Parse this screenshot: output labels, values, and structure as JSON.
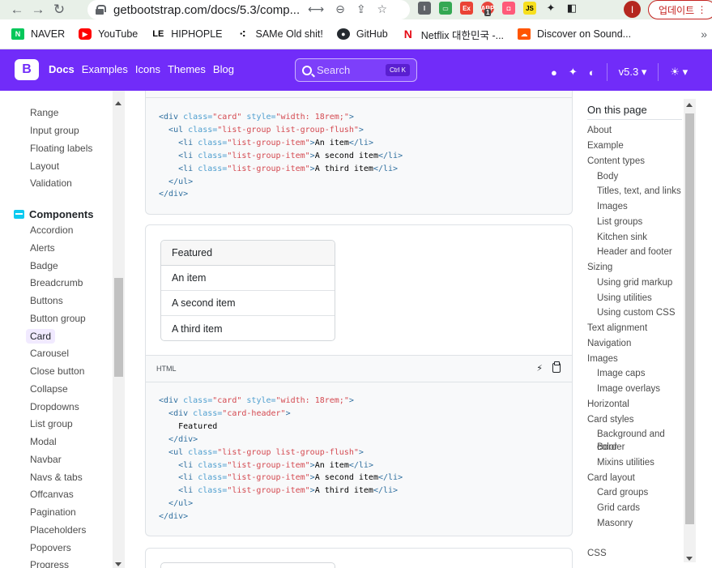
{
  "browser": {
    "url": "getbootstrap.com/docs/5.3/comp...",
    "profile_initial": "I",
    "update_label": "업데이트",
    "ext_badge": "1"
  },
  "bookmarks": [
    "NAVER",
    "YouTube",
    "HIPHOPLE",
    "SAMe Old shit!",
    "GitHub",
    "Netflix 대한민국 -...",
    "Discover on Sound..."
  ],
  "bookmark_more": "»",
  "navbar": {
    "logo": "B",
    "links": [
      "Docs",
      "Examples",
      "Icons",
      "Themes",
      "Blog"
    ],
    "search_placeholder": "Search",
    "search_kbd": "Ctrl K",
    "version": "v5.3"
  },
  "sidebar": {
    "top_items": [
      "Range",
      "Input group",
      "Floating labels",
      "Layout",
      "Validation"
    ],
    "section": "Components",
    "items": [
      "Accordion",
      "Alerts",
      "Badge",
      "Breadcrumb",
      "Buttons",
      "Button group",
      "Card",
      "Carousel",
      "Close button",
      "Collapse",
      "Dropdowns",
      "List group",
      "Modal",
      "Navbar",
      "Navs & tabs",
      "Offcanvas",
      "Pagination",
      "Placeholders",
      "Popovers",
      "Progress"
    ],
    "active": "Card"
  },
  "example": {
    "card_header": "Featured",
    "items": [
      "An item",
      "A second item",
      "A third item"
    ],
    "code_label": "HTML"
  },
  "toc": {
    "title": "On this page",
    "items": [
      {
        "label": "About",
        "indent": 0
      },
      {
        "label": "Example",
        "indent": 0
      },
      {
        "label": "Content types",
        "indent": 0
      },
      {
        "label": "Body",
        "indent": 1
      },
      {
        "label": "Titles, text, and links",
        "indent": 1
      },
      {
        "label": "Images",
        "indent": 1
      },
      {
        "label": "List groups",
        "indent": 1
      },
      {
        "label": "Kitchen sink",
        "indent": 1
      },
      {
        "label": "Header and footer",
        "indent": 1
      },
      {
        "label": "Sizing",
        "indent": 0
      },
      {
        "label": "Using grid markup",
        "indent": 1
      },
      {
        "label": "Using utilities",
        "indent": 1
      },
      {
        "label": "Using custom CSS",
        "indent": 1
      },
      {
        "label": "Text alignment",
        "indent": 0
      },
      {
        "label": "Navigation",
        "indent": 0
      },
      {
        "label": "Images",
        "indent": 0
      },
      {
        "label": "Image caps",
        "indent": 1
      },
      {
        "label": "Image overlays",
        "indent": 1
      },
      {
        "label": "Horizontal",
        "indent": 0
      },
      {
        "label": "Card styles",
        "indent": 0
      },
      {
        "label": "Background and color",
        "indent": 1
      },
      {
        "label": "Border",
        "indent": 1
      },
      {
        "label": "Mixins utilities",
        "indent": 1
      },
      {
        "label": "Card layout",
        "indent": 0
      },
      {
        "label": "Card groups",
        "indent": 1
      },
      {
        "label": "Grid cards",
        "indent": 1
      },
      {
        "label": "Masonry",
        "indent": 1
      },
      {
        "label": "CSS",
        "indent": 0
      }
    ]
  }
}
